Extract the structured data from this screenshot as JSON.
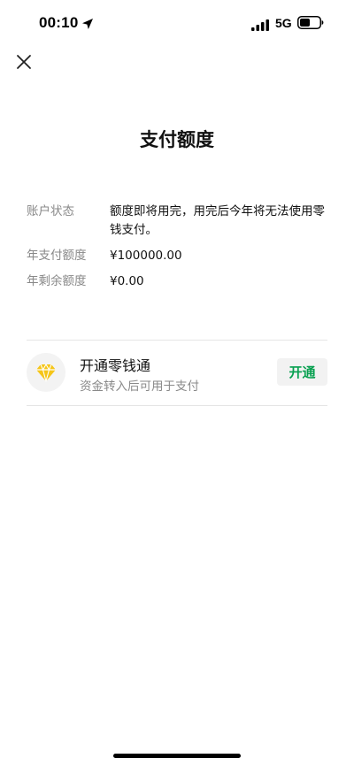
{
  "status_bar": {
    "time": "00:10",
    "network": "5G",
    "location_icon": "location-arrow-icon",
    "signal_icon": "cellular-signal-icon",
    "battery_icon": "battery-icon"
  },
  "header": {
    "close_icon": "close-icon",
    "title": "支付额度"
  },
  "account_info": {
    "status_label": "账户状态",
    "status_value": "额度即将用完，用完后今年将无法使用零钱支付。",
    "annual_limit_label": "年支付额度",
    "annual_limit_value": "¥100000.00",
    "remaining_label": "年剩余额度",
    "remaining_value": "¥0.00"
  },
  "lingqiantong": {
    "icon": "diamond-icon",
    "title": "开通零钱通",
    "subtitle": "资金转入后可用于支付",
    "button_label": "开通"
  },
  "colors": {
    "accent_green": "#07a050",
    "diamond_yellow": "#f5c518",
    "label_gray": "#888888"
  }
}
